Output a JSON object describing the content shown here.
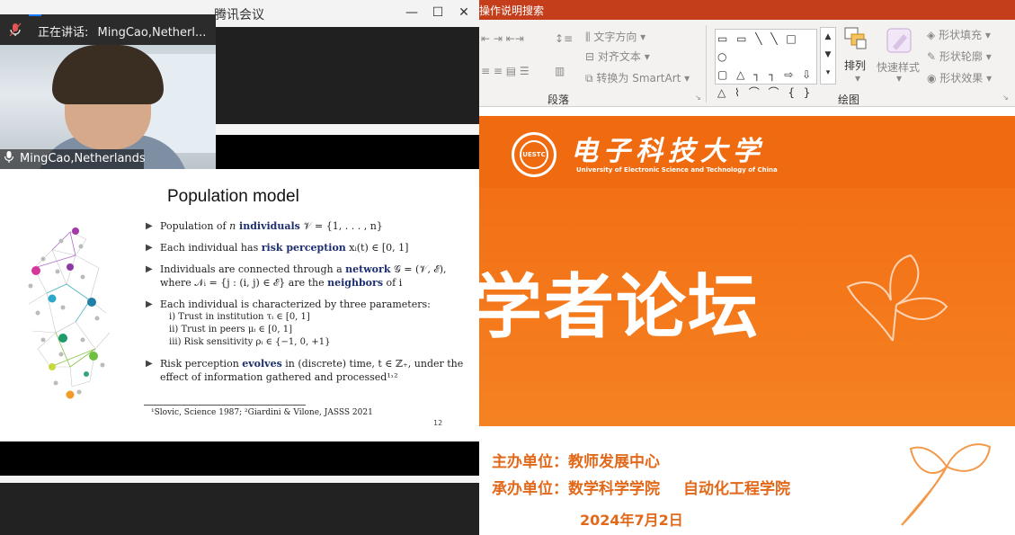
{
  "meeting": {
    "app_title": "腾讯会议",
    "speaking_label": "正在讲话:",
    "speaking_name": "MingCao,Netherl...",
    "video_name": "MingCao,Netherlands",
    "window_buttons": {
      "minimize": "—",
      "maximize": "☐",
      "close": "✕"
    }
  },
  "slide": {
    "title": "Population model",
    "bullets": [
      {
        "pre": "Population of ",
        "math": "n",
        "kw": " individuals",
        "post": " 𝒱 = {1, . . . , n}"
      },
      {
        "pre": "Each individual has ",
        "kw": "risk perception",
        "post": " xᵢ(t) ∈ [0, 1]"
      },
      {
        "pre": "Individuals are connected through a ",
        "kw": "network",
        "post": " 𝒢 = (𝒱, ℰ),",
        "line2_pre": "where 𝒩ᵢ = {j : (i, j) ∈ ℰ} are the ",
        "line2_kw": "neighbors",
        "line2_post": " of i"
      },
      {
        "pre": "Each individual is characterized by three parameters:"
      },
      {
        "pre": "Risk perception ",
        "kw": "evolves",
        "post": " in (discrete) time, t ∈ ℤ₊, under the",
        "line2_pre": "effect of information gathered and processed¹˒²"
      }
    ],
    "sub_params": [
      "i)  Trust in institution τᵢ ∈ [0, 1]",
      "ii)  Trust in peers μᵢ ∈ [0, 1]",
      "iii)  Risk sensitivity ρᵢ ∈ {−1, 0, +1}"
    ],
    "footnote": "¹Slovic, Science 1987; ²Giardini & Vilone, JASSS 2021",
    "page_number": "12"
  },
  "ppt": {
    "search_hint": "操作说明搜索",
    "ribbon": {
      "text_direction": "文字方向",
      "align_text": "对齐文本",
      "convert_smartart": "转换为 SmartArt",
      "paragraph_group": "段落",
      "arrange": "排列",
      "quick_styles": "快速样式",
      "shape_fill": "形状填充",
      "shape_outline": "形状轮廓",
      "shape_effects": "形状效果",
      "drawing_group": "绘图"
    },
    "slide": {
      "university_cn": "电子科技大学",
      "university_en": "University of Electronic Science and Technology of China",
      "logo_text": "UESTC",
      "forum_title": "学者论坛",
      "host_label": "主办单位：",
      "host": "教师发展中心",
      "organizer_label": "承办单位：",
      "organizer_1": "数学科学学院",
      "organizer_2": "自动化工程学院",
      "date": "2024年7月2日"
    }
  },
  "colors": {
    "brand_orange": "#f26a12",
    "title_bar_red": "#c43e1c",
    "slide_keyword": "#1d2f6e"
  }
}
